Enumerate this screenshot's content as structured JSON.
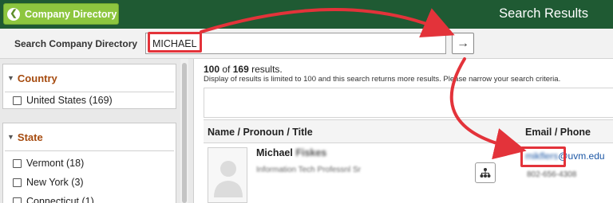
{
  "header": {
    "back_label": "Company Directory",
    "title": "Search Results"
  },
  "search": {
    "label": "Search Company Directory",
    "value": "MICHAEL"
  },
  "filters": {
    "country": {
      "heading": "Country",
      "items": [
        {
          "label": "United States (169)"
        }
      ]
    },
    "state": {
      "heading": "State",
      "items": [
        {
          "label": "Vermont (18)"
        },
        {
          "label": "New York (3)"
        },
        {
          "label": "Connecticut (1)"
        }
      ]
    }
  },
  "results": {
    "shown": "100",
    "of_text": " of ",
    "total": "169",
    "suffix": " results.",
    "disclaimer": "Display of results is limited to 100 and this search returns more results. Please narrow your search criteria.",
    "columns": {
      "name": "Name / Pronoun / Title",
      "email": "Email / Phone"
    },
    "rows": [
      {
        "first_name": "Michael",
        "last_name_redacted": "Fiskes",
        "title_redacted": "Information Tech Professnl Sr",
        "email_redacted": "mikflers",
        "email_domain": "@uvm.edu",
        "phone_redacted": "802-656-4308"
      }
    ]
  },
  "annotation": {
    "color": "#e3333a"
  },
  "colors": {
    "header_bg": "#1f5a33",
    "back_button": "#8dc63f",
    "facet_heading": "#a64b0f",
    "link": "#1c57a5"
  }
}
